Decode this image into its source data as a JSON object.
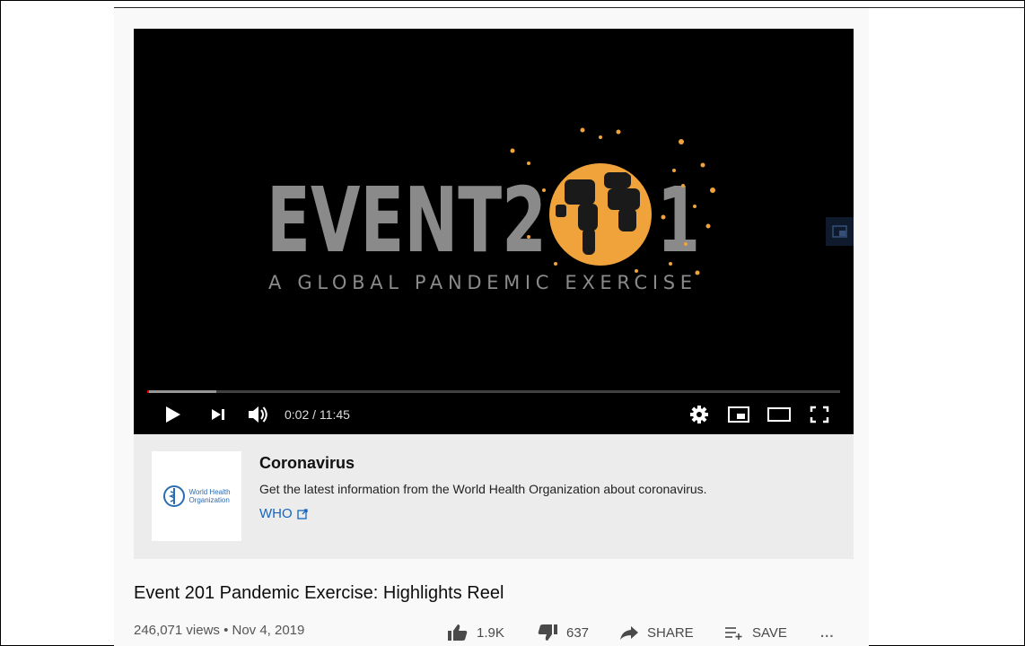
{
  "player": {
    "logo_text_left": "EVENT2",
    "logo_text_right": "1",
    "logo_subtitle": "A GLOBAL PANDEMIC EXERCISE",
    "time_display": "0:02 / 11:45",
    "progress_fraction": 0.003,
    "buffer_fraction": 0.1,
    "colors": {
      "logo_gray": "#8a8a8a",
      "globe_orange": "#f0a33a",
      "progress_red": "#ff0000"
    },
    "icons": [
      "play-icon",
      "next-icon",
      "volume-icon",
      "settings-icon",
      "miniplayer-icon",
      "theater-icon",
      "fullscreen-icon"
    ]
  },
  "info_panel": {
    "logo_line1": "World Health",
    "logo_line2": "Organization",
    "title": "Coronavirus",
    "description": "Get the latest information from the World Health Organization about coronavirus.",
    "link_label": "WHO",
    "link_icon": "external-link-icon"
  },
  "video": {
    "title": "Event 201 Pandemic Exercise: Highlights Reel",
    "views_date": "246,071 views • Nov 4, 2019",
    "likes": "1.9K",
    "dislikes": "637",
    "share_label": "SHARE",
    "save_label": "SAVE",
    "more_label": "..."
  }
}
